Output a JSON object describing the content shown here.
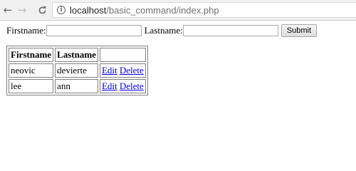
{
  "browser": {
    "url_host": "localhost",
    "url_path": "/basic_command/index.php",
    "icons": {
      "back": "arrow-left-icon",
      "forward": "arrow-right-icon",
      "reload": "reload-icon",
      "site_info": "info-icon"
    }
  },
  "form": {
    "firstname_label": "Firstname:",
    "firstname_value": "",
    "lastname_label": "Lastname:",
    "lastname_value": "",
    "submit_label": "Submit"
  },
  "table": {
    "headers": [
      "Firstname",
      "Lastname",
      ""
    ],
    "rows": [
      {
        "firstname": "neovic",
        "lastname": "devierte",
        "edit_label": "Edit",
        "delete_label": "Delete"
      },
      {
        "firstname": "lee",
        "lastname": "ann",
        "edit_label": "Edit",
        "delete_label": "Delete"
      }
    ]
  },
  "colors": {
    "link": "#0000ee",
    "chrome_bg": "#f1f1f1"
  }
}
